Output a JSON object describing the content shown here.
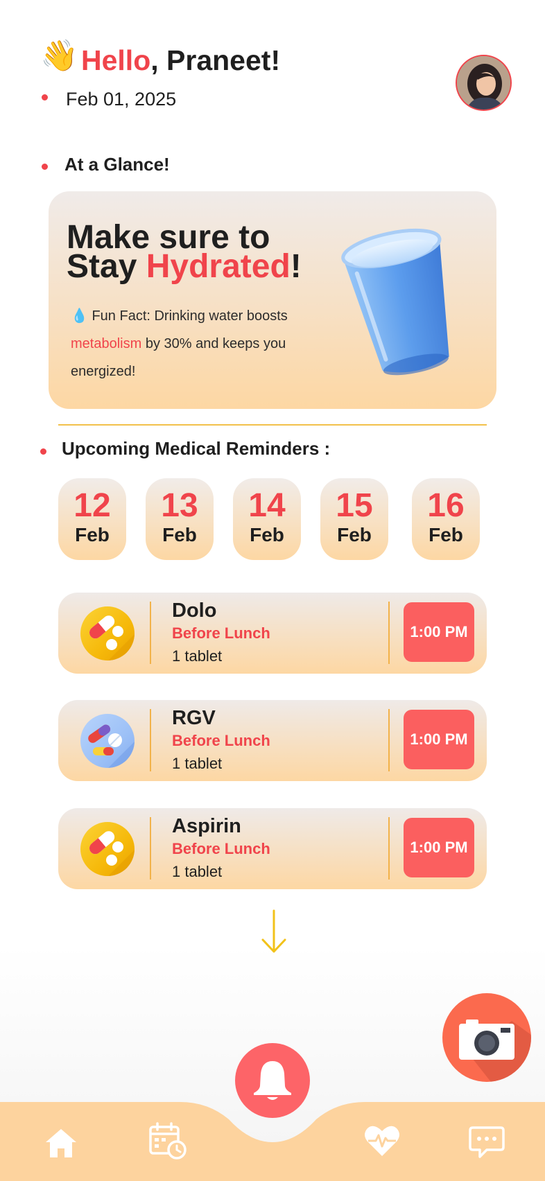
{
  "header": {
    "wave_emoji": "👋",
    "greeting_highlight": "Hello",
    "greeting_rest": ", Praneet!",
    "date": "Feb 01, 2025"
  },
  "glance": {
    "title": "At a Glance!",
    "headline_line1": "Make sure to",
    "headline_line2_prefix": "Stay ",
    "headline_line2_highlight": "Hydrated",
    "headline_line2_suffix": "!",
    "funfact_drop": "💧",
    "funfact_prefix": " Fun Fact: Drinking water boosts ",
    "funfact_highlight": "metabolism",
    "funfact_suffix": " by 30% and keeps you energized!"
  },
  "reminders": {
    "title": "Upcoming Medical Reminders :",
    "dates": [
      {
        "day": "12",
        "month": "Feb"
      },
      {
        "day": "13",
        "month": "Feb"
      },
      {
        "day": "14",
        "month": "Feb"
      },
      {
        "day": "15",
        "month": "Feb"
      },
      {
        "day": "16",
        "month": "Feb"
      }
    ],
    "items": [
      {
        "name": "Dolo",
        "when": "Before Lunch",
        "dose": "1 tablet",
        "time": "1:00 PM",
        "icon": "pill-yellow-icon"
      },
      {
        "name": "RGV",
        "when": "Before Lunch",
        "dose": "1 tablet",
        "time": "1:00 PM",
        "icon": "pill-blue-icon"
      },
      {
        "name": "Aspirin",
        "when": "Before Lunch",
        "dose": "1 tablet",
        "time": "1:00 PM",
        "icon": "pill-yellow-icon"
      }
    ]
  },
  "colors": {
    "accent": "#f0444b",
    "card_bottom": "#fdd7a3",
    "time_button": "#fb5f5f",
    "divider": "#f2c14a",
    "nav_bg": "#fdd39e"
  },
  "nav": {
    "items": [
      "home-icon",
      "calendar-icon",
      "bell-icon",
      "heart-pulse-icon",
      "chat-icon"
    ]
  }
}
